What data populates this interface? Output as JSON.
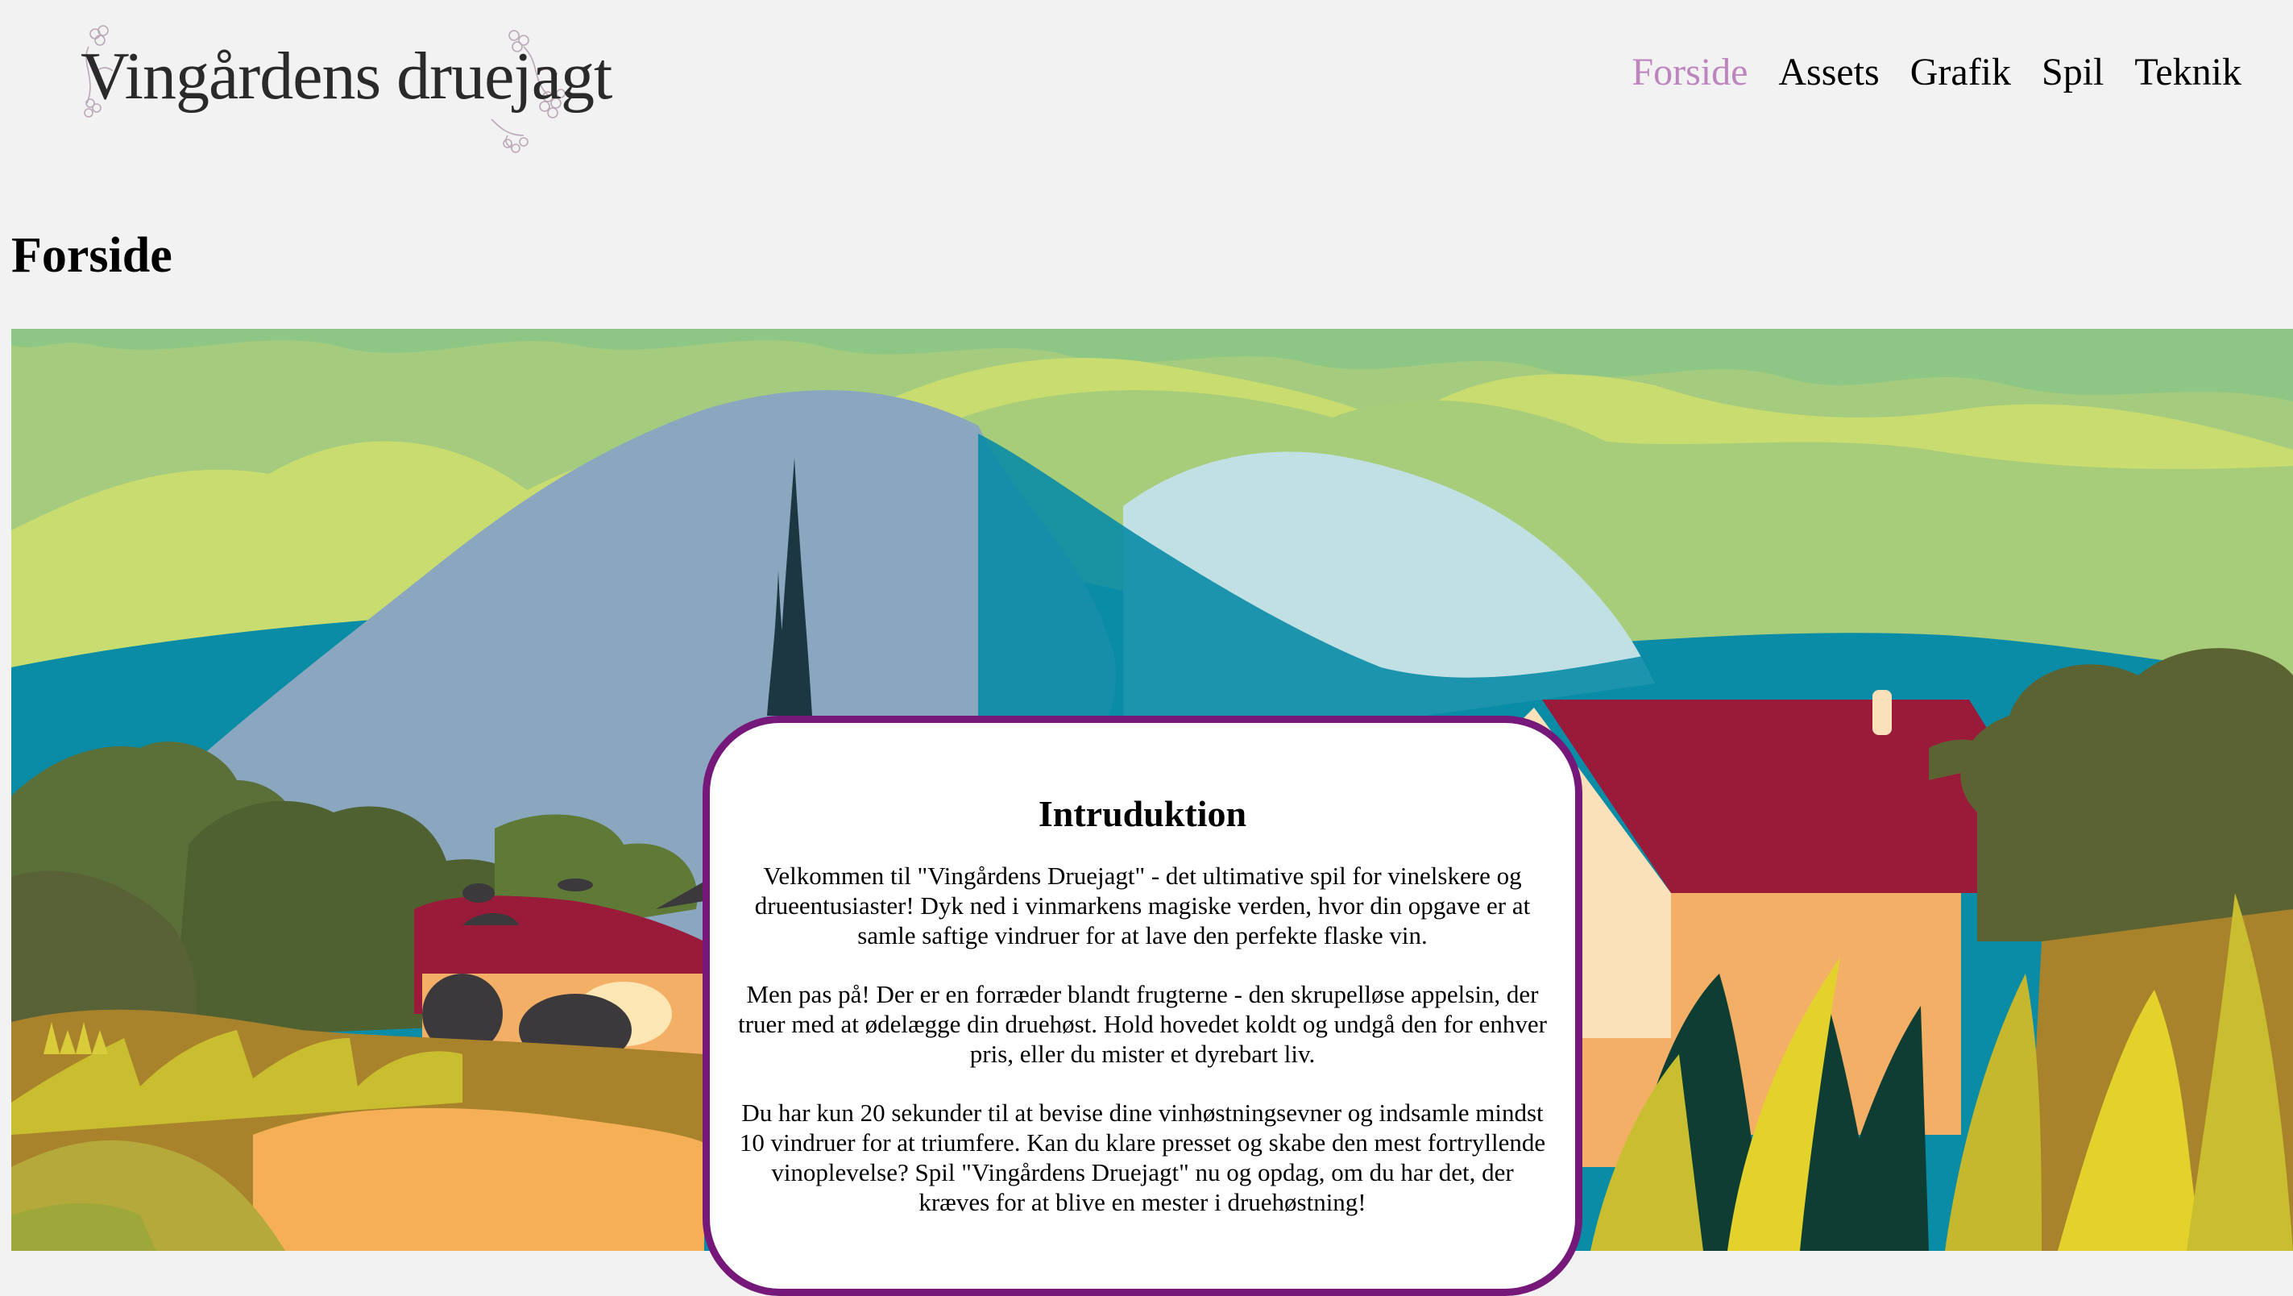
{
  "site": {
    "logo_text": "Vingårdens druejagt"
  },
  "nav": {
    "items": [
      {
        "label": "Forside",
        "active": true
      },
      {
        "label": "Assets",
        "active": false
      },
      {
        "label": "Grafik",
        "active": false
      },
      {
        "label": "Spil",
        "active": false
      },
      {
        "label": "Teknik",
        "active": false
      }
    ]
  },
  "page": {
    "title": "Forside"
  },
  "intro": {
    "heading": "Intruduktion",
    "paragraphs": [
      "Velkommen til \"Vingårdens Druejagt\" - det ultimative spil for vinelskere og drueentusiaster! Dyk ned i vinmarkens magiske verden, hvor din opgave er at samle saftige vindruer for at lave den perfekte flaske vin.",
      "Men pas på! Der er en forræder blandt frugterne - den skrupelløse appelsin, der truer med at ødelægge din druehøst. Hold hovedet koldt og undgå den for enhver pris, eller du mister et dyrebart liv.",
      "Du har kun 20 sekunder til at bevise dine vinhøstningsevner og indsamle mindst 10 vindruer for at triumfere. Kan du klare presset og skabe den mest fortryllende vinoplevelse? Spil \"Vingårdens Druejagt\" nu og opdag, om du har det, der kræves for at blive en mester i druehøstning!"
    ]
  },
  "colors": {
    "background": "#f2f2f2",
    "nav_active": "#bd85bd",
    "card_border": "#75187a"
  }
}
